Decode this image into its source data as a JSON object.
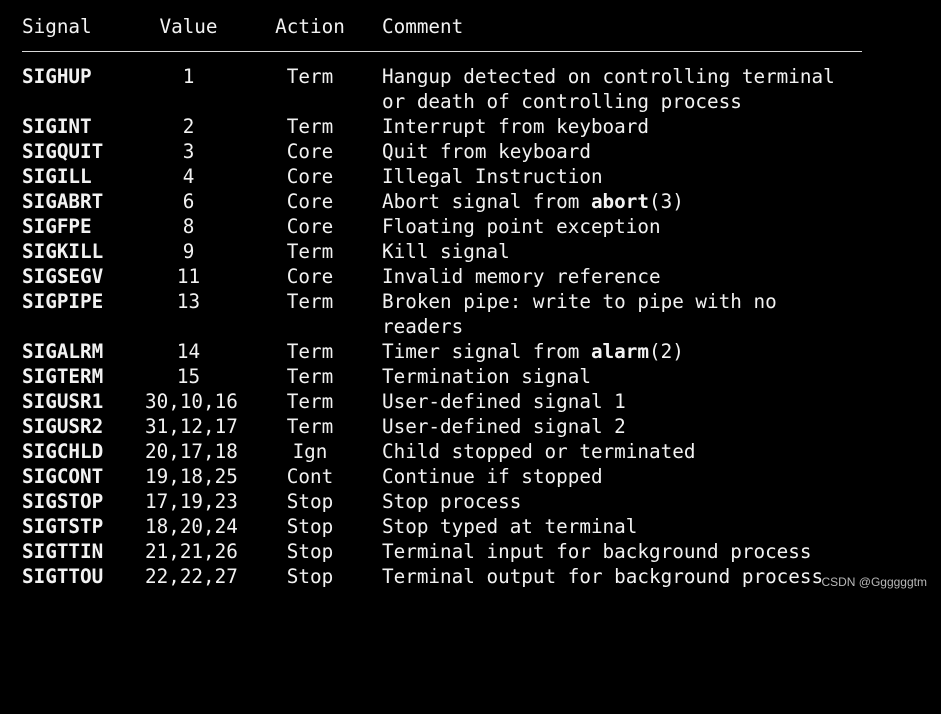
{
  "header": {
    "signal": "Signal",
    "value": "Value",
    "action": "Action",
    "comment": "Comment"
  },
  "rows": [
    {
      "signal": "SIGHUP",
      "value": "1",
      "action": "Term",
      "comment": "Hangup detected on controlling terminal",
      "comment2": "or death of controlling process"
    },
    {
      "signal": "SIGINT",
      "value": "2",
      "action": "Term",
      "comment": "Interrupt from keyboard"
    },
    {
      "signal": "SIGQUIT",
      "value": "3",
      "action": "Core",
      "comment": "Quit from keyboard"
    },
    {
      "signal": "SIGILL",
      "value": "4",
      "action": "Core",
      "comment": "Illegal Instruction"
    },
    {
      "signal": "SIGABRT",
      "value": "6",
      "action": "Core",
      "comment_pre": "Abort signal from ",
      "comment_bold": "abort",
      "comment_post": "(3)"
    },
    {
      "signal": "SIGFPE",
      "value": "8",
      "action": "Core",
      "comment": "Floating point exception"
    },
    {
      "signal": "SIGKILL",
      "value": "9",
      "action": "Term",
      "comment": "Kill signal"
    },
    {
      "signal": "SIGSEGV",
      "value": "11",
      "action": "Core",
      "comment": "Invalid memory reference"
    },
    {
      "signal": "SIGPIPE",
      "value": "13",
      "action": "Term",
      "comment": "Broken pipe: write to pipe with no",
      "comment2": "readers"
    },
    {
      "signal": "SIGALRM",
      "value": "14",
      "action": "Term",
      "comment_pre": "Timer signal from ",
      "comment_bold": "alarm",
      "comment_post": "(2)"
    },
    {
      "signal": "SIGTERM",
      "value": "15",
      "action": "Term",
      "comment": "Termination signal"
    },
    {
      "signal": "SIGUSR1",
      "value": "30,10,16",
      "action": "Term",
      "comment": "User-defined signal 1"
    },
    {
      "signal": "SIGUSR2",
      "value": "31,12,17",
      "action": "Term",
      "comment": "User-defined signal 2"
    },
    {
      "signal": "SIGCHLD",
      "value": "20,17,18",
      "action": "Ign",
      "comment": "Child stopped or terminated"
    },
    {
      "signal": "SIGCONT",
      "value": "19,18,25",
      "action": "Cont",
      "comment": "Continue if stopped"
    },
    {
      "signal": "SIGSTOP",
      "value": "17,19,23",
      "action": "Stop",
      "comment": "Stop process"
    },
    {
      "signal": "SIGTSTP",
      "value": "18,20,24",
      "action": "Stop",
      "comment": "Stop typed at terminal"
    },
    {
      "signal": "SIGTTIN",
      "value": "21,21,26",
      "action": "Stop",
      "comment": "Terminal input for background process"
    },
    {
      "signal": "SIGTTOU",
      "value": "22,22,27",
      "action": "Stop",
      "comment": "Terminal output for background process"
    }
  ],
  "watermark": "CSDN @Ggggggtm"
}
